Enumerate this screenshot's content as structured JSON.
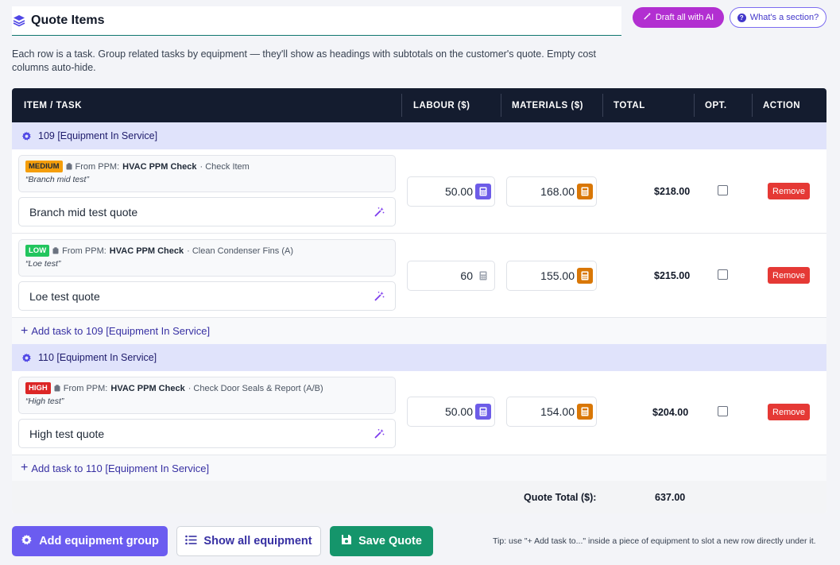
{
  "header": {
    "title": "Quote Items",
    "ai_button": "Draft all with AI",
    "help_button": "What's a section?"
  },
  "description": "Each row is a task. Group related tasks by equipment — they'll show as headings with subtotals on the customer's quote. Empty cost columns auto-hide.",
  "table": {
    "columns": {
      "item": "ITEM / TASK",
      "labour": "LABOUR ($)",
      "materials": "MATERIALS ($)",
      "total": "TOTAL",
      "opt": "OPT.",
      "action": "ACTION"
    },
    "groups": [
      {
        "name": "109 [Equipment In Service]",
        "add_task": "Add task to 109 [Equipment In Service]",
        "tasks": [
          {
            "priority": "MEDIUM",
            "from_prefix": "From PPM:",
            "ppm": "HVAC PPM Check",
            "step": "· Check Item",
            "note": "“Branch mid test”",
            "description": "Branch mid test quote",
            "labour": "50.00",
            "materials": "168.00",
            "total": "$218.00",
            "optional": false,
            "remove": "Remove"
          },
          {
            "priority": "LOW",
            "from_prefix": "From PPM:",
            "ppm": "HVAC PPM Check",
            "step": "· Clean Condenser Fins (A)",
            "note": "“Loe test”",
            "description": "Loe test quote",
            "labour": "60",
            "materials": "155.00",
            "total": "$215.00",
            "optional": false,
            "remove": "Remove"
          }
        ]
      },
      {
        "name": "110 [Equipment In Service]",
        "add_task": "Add task to 110 [Equipment In Service]",
        "tasks": [
          {
            "priority": "HIGH",
            "from_prefix": "From PPM:",
            "ppm": "HVAC PPM Check",
            "step": "· Check Door Seals & Report (A/B)",
            "note": "“High test”",
            "description": "High test quote",
            "labour": "50.00",
            "materials": "154.00",
            "total": "$204.00",
            "optional": false,
            "remove": "Remove"
          }
        ]
      }
    ],
    "footer": {
      "label": "Quote Total ($):",
      "value": "637.00"
    }
  },
  "actions": {
    "add_group": "Add equipment group",
    "show_all": "Show all equipment",
    "save": "Save Quote"
  },
  "tip": "Tip: use \"+ Add task to...\" inside a piece of equipment to slot a new row directly under it.",
  "colors": {
    "header_bg": "#141c2f",
    "group_bg": "#e0e3fb",
    "accent_purple": "#6b5cf0",
    "ai_magenta": "#b22fd1",
    "save_green": "#15956b",
    "remove_red": "#e53935",
    "calc_orange": "#d97706"
  },
  "icons": {
    "title": "layers-icon",
    "group": "gear-icon",
    "wand": "magic-wand-icon",
    "calculator": "calculator-icon",
    "clipboard": "clipboard-icon",
    "list": "list-icon",
    "save": "floppy-disk-icon"
  }
}
